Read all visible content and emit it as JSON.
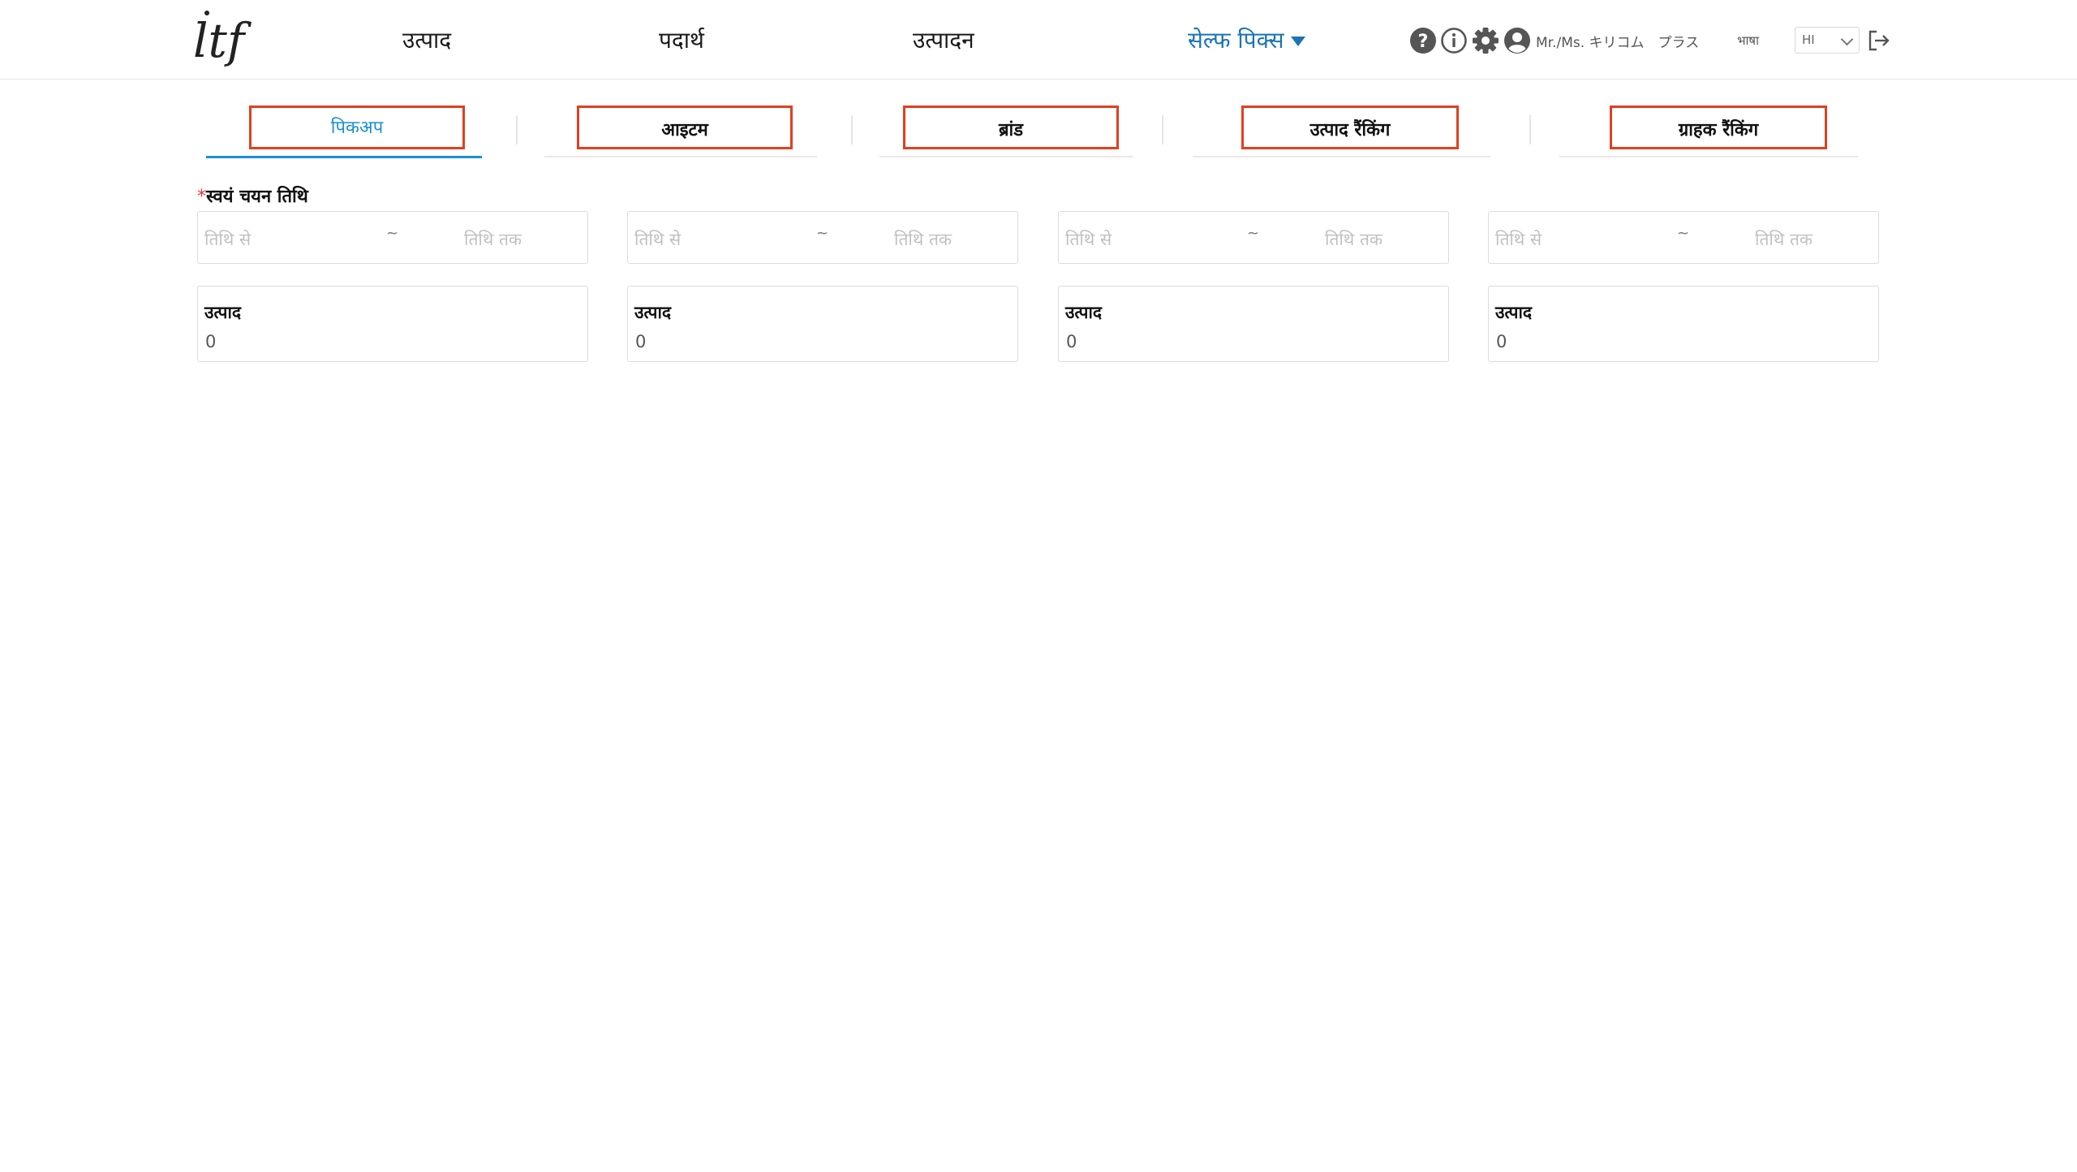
{
  "header": {
    "logo_alt": "ltf",
    "nav": [
      {
        "label": "उत्पाद"
      },
      {
        "label": "पदार्थ"
      },
      {
        "label": "उत्पादन"
      },
      {
        "label": "सेल्फ पिक्स",
        "active": true
      }
    ],
    "icons": [
      "help-icon",
      "info-icon",
      "settings-gear-icon",
      "user-avatar-icon",
      "logout-icon"
    ],
    "user_name": "Mr./Ms. キリコム　プラス",
    "language_label": "भाषा",
    "language_value": "HI"
  },
  "tabs": [
    {
      "label": "पिकअप",
      "active": true
    },
    {
      "label": "आइटम"
    },
    {
      "label": "ब्रांड"
    },
    {
      "label": "उत्पाद रैंकिंग"
    },
    {
      "label": "ग्राहक रैंकिंग"
    }
  ],
  "filter": {
    "required_mark": "*",
    "label": "स्वयं चयन तिथि"
  },
  "columns": [
    {
      "date_from_placeholder": "तिथि से",
      "separator": "~",
      "date_to_placeholder": "तिथि तक",
      "card_title": "उत्पाद",
      "card_value": "0"
    },
    {
      "date_from_placeholder": "तिथि से",
      "separator": "~",
      "date_to_placeholder": "तिथि तक",
      "card_title": "उत्पाद",
      "card_value": "0"
    },
    {
      "date_from_placeholder": "तिथि से",
      "separator": "~",
      "date_to_placeholder": "तिथि तक",
      "card_title": "उत्पाद",
      "card_value": "0"
    },
    {
      "date_from_placeholder": "तिथि से",
      "separator": "~",
      "date_to_placeholder": "तिथि तक",
      "card_title": "उत्पाद",
      "card_value": "0"
    }
  ],
  "colors": {
    "accent": "#1b8fd6",
    "highlight_box": "#e0401f",
    "required": "#e53935"
  }
}
